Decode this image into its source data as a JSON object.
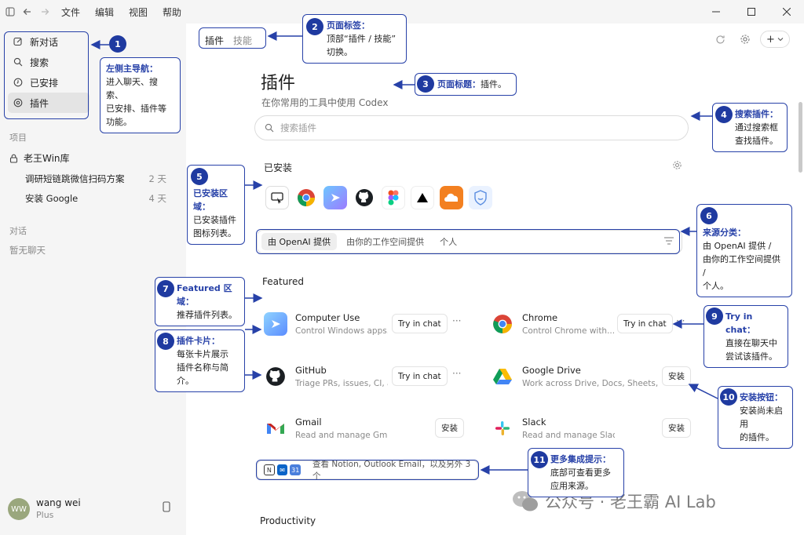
{
  "menu": [
    "文件",
    "编辑",
    "视图",
    "帮助"
  ],
  "sidebar": {
    "nav": [
      {
        "label": "新对话",
        "icon": "edit-icon"
      },
      {
        "label": "搜索",
        "icon": "search-icon"
      },
      {
        "label": "已安排",
        "icon": "clock-icon"
      },
      {
        "label": "插件",
        "icon": "plugin-icon",
        "active": true
      }
    ],
    "projects_label": "项目",
    "project_name": "老王Win库",
    "chats": [
      {
        "title": "调研短链跳微信扫码方案",
        "when": "2 天"
      },
      {
        "title": "安装 Google",
        "when": "4 天"
      }
    ],
    "conversations_label": "对话",
    "no_conversations": "暂无聊天",
    "user": {
      "initials": "WW",
      "name": "wang wei",
      "plan": "Plus"
    }
  },
  "main": {
    "tabs": [
      {
        "label": "插件",
        "active": true
      },
      {
        "label": "技能",
        "active": false
      }
    ],
    "title": "插件",
    "subtitle": "在你常用的工具中使用 Codex",
    "search_placeholder": "搜索插件",
    "installed_label": "已安装",
    "installed_icons": [
      "computer-use-icon",
      "chrome-icon",
      "codex-icon",
      "github-icon",
      "figma-icon",
      "vercel-icon",
      "cloudflare-icon",
      "shield-smile-icon"
    ],
    "source_tabs": [
      {
        "label": "由 OpenAI 提供",
        "active": true
      },
      {
        "label": "由你的工作空间提供"
      },
      {
        "label": "个人"
      }
    ],
    "featured_label": "Featured",
    "cards": [
      {
        "name": "Computer Use",
        "desc": "Control Windows apps...",
        "action": "Try in chat",
        "more": "···"
      },
      {
        "name": "Chrome",
        "desc": "Control Chrome with...",
        "action": "Try in chat",
        "more": "···"
      },
      {
        "name": "GitHub",
        "desc": "Triage PRs, issues, CI, an...",
        "action": "Try in chat",
        "more": "···"
      },
      {
        "name": "Google Drive",
        "desc": "Work across Drive, Docs, Sheets, and...",
        "action": "安装"
      },
      {
        "name": "Gmail",
        "desc": "Read and manage Gmail",
        "action": "安装"
      },
      {
        "name": "Slack",
        "desc": "Read and manage Slack",
        "action": "安装"
      }
    ],
    "more_integrations": "查看 Notion, Outlook Email，以及另外 3 个",
    "calendar_day": "31",
    "productivity_label": "Productivity"
  },
  "annotations": [
    {
      "num": "1",
      "title": "左侧主导航：",
      "body": "进入聊天、搜索、\n已安排、插件等\n功能。"
    },
    {
      "num": "2",
      "title": "页面标签：",
      "body": "顶部“插件 / 技能”\n切换。"
    },
    {
      "num": "3",
      "title": "页面标题：",
      "body": "插件。"
    },
    {
      "num": "4",
      "title": "搜索插件：",
      "body": "通过搜索框\n查找插件。"
    },
    {
      "num": "5",
      "title": "已安装区域：",
      "body": "已安装插件\n图标列表。"
    },
    {
      "num": "6",
      "title": "来源分类：",
      "body": "由 OpenAI 提供 /\n由你的工作空间提供 /\n个人。"
    },
    {
      "num": "7",
      "title": "Featured 区域：",
      "body": "推荐插件列表。"
    },
    {
      "num": "8",
      "title": "插件卡片：",
      "body": "每张卡片展示\n插件名称与简介。"
    },
    {
      "num": "9",
      "title": "Try in chat：",
      "body": "直接在聊天中\n尝试该插件。"
    },
    {
      "num": "10",
      "title": "安装按钮：",
      "body": "安装尚未启用\n的插件。"
    },
    {
      "num": "11",
      "title": "更多集成提示：",
      "body": "底部可查看更多\n应用来源。"
    }
  ],
  "watermark": "公众号 · 老王霸 AI Lab",
  "accent_color": "#2741a8"
}
